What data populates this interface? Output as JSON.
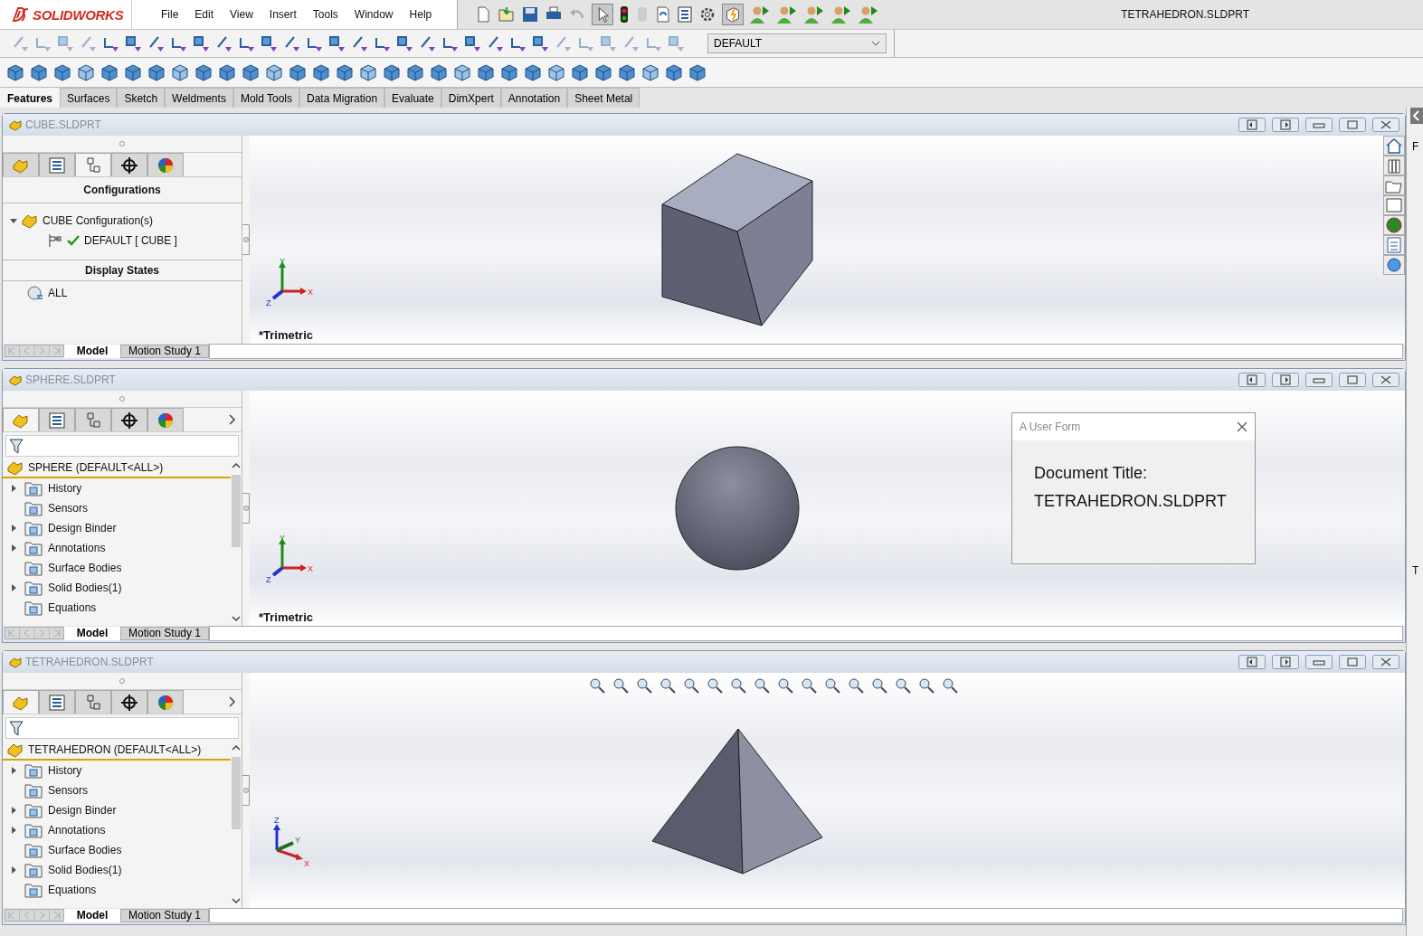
{
  "app": {
    "logo_text": "SOLIDWORKS",
    "menu": [
      "File",
      "Edit",
      "View",
      "Insert",
      "Tools",
      "Window",
      "Help"
    ],
    "title": "TETRAHEDRON.SLDPRT"
  },
  "configuration_dropdown": {
    "value": "DEFAULT"
  },
  "command_tabs": [
    {
      "label": "Features",
      "selected": true
    },
    {
      "label": "Surfaces",
      "selected": false
    },
    {
      "label": "Sketch",
      "selected": false
    },
    {
      "label": "Weldments",
      "selected": false
    },
    {
      "label": "Mold Tools",
      "selected": false
    },
    {
      "label": "Data Migration",
      "selected": false
    },
    {
      "label": "Evaluate",
      "selected": false
    },
    {
      "label": "DimXpert",
      "selected": false
    },
    {
      "label": "Annotation",
      "selected": false
    },
    {
      "label": "Sheet Metal",
      "selected": false
    }
  ],
  "documents": [
    {
      "title": "CUBE.SLDPRT",
      "model": {
        "kind": "cube"
      },
      "triad": {
        "kind": "y_up",
        "up": "Y",
        "right": "X",
        "third": "Z"
      },
      "view_label": "*Trimetric",
      "heads_up_toolbar": false,
      "task_pane": true,
      "panel_tabs": [
        {
          "selected": false
        },
        {
          "selected": false
        },
        {
          "selected": true
        },
        {
          "selected": false
        },
        {
          "selected": false
        }
      ],
      "panel": {
        "kind": "configurations",
        "heading": "Configurations",
        "root": {
          "label": "CUBE Configuration(s)",
          "expanded": true,
          "children": [
            {
              "label": "DEFAULT [ CUBE ]",
              "active": true
            }
          ]
        },
        "states_heading": "Display States",
        "states": [
          "ALL"
        ]
      },
      "bottom_tabs": [
        {
          "label": "Model",
          "selected": true
        },
        {
          "label": "Motion Study 1",
          "selected": false
        }
      ]
    },
    {
      "title": "SPHERE.SLDPRT",
      "model": {
        "kind": "sphere"
      },
      "triad": {
        "kind": "y_up",
        "up": "Y",
        "right": "X",
        "third": "Z"
      },
      "view_label": "*Trimetric",
      "heads_up_toolbar": false,
      "task_pane": false,
      "panel_tabs": [
        {
          "selected": true
        },
        {
          "selected": false
        },
        {
          "selected": false
        },
        {
          "selected": false
        },
        {
          "selected": false
        }
      ],
      "panel": {
        "kind": "feature_tree",
        "root": "SPHERE  (DEFAULT<ALL>)",
        "items": [
          {
            "label": "History",
            "expandable": true
          },
          {
            "label": "Sensors",
            "expandable": false
          },
          {
            "label": "Design Binder",
            "expandable": true
          },
          {
            "label": "Annotations",
            "expandable": true
          },
          {
            "label": "Surface Bodies",
            "expandable": false
          },
          {
            "label": "Solid Bodies(1)",
            "expandable": true
          },
          {
            "label": "Equations",
            "expandable": false
          }
        ]
      },
      "bottom_tabs": [
        {
          "label": "Model",
          "selected": true
        },
        {
          "label": "Motion Study 1",
          "selected": false
        }
      ],
      "user_form": {
        "title": "A User Form",
        "lines": [
          "Document Title:",
          "TETRAHEDRON.SLDPRT"
        ]
      }
    },
    {
      "title": "TETRAHEDRON.SLDPRT",
      "model": {
        "kind": "tetrahedron"
      },
      "triad": {
        "kind": "z_up",
        "up": "Z",
        "right": "X",
        "third": "Y"
      },
      "heads_up_toolbar": true,
      "task_pane": false,
      "panel_tabs": [
        {
          "selected": true
        },
        {
          "selected": false
        },
        {
          "selected": false
        },
        {
          "selected": false
        },
        {
          "selected": false
        }
      ],
      "panel": {
        "kind": "feature_tree",
        "root": "TETRAHEDRON  (DEFAULT<ALL>)",
        "items": [
          {
            "label": "History",
            "expandable": true
          },
          {
            "label": "Sensors",
            "expandable": false
          },
          {
            "label": "Design Binder",
            "expandable": true
          },
          {
            "label": "Annotations",
            "expandable": true
          },
          {
            "label": "Surface Bodies",
            "expandable": false
          },
          {
            "label": "Solid Bodies(1)",
            "expandable": true
          },
          {
            "label": "Equations",
            "expandable": false
          }
        ]
      },
      "bottom_tabs": [
        {
          "label": "Model",
          "selected": true
        },
        {
          "label": "Motion Study 1",
          "selected": false
        }
      ]
    }
  ],
  "right_edge": [
    "F",
    "T"
  ]
}
